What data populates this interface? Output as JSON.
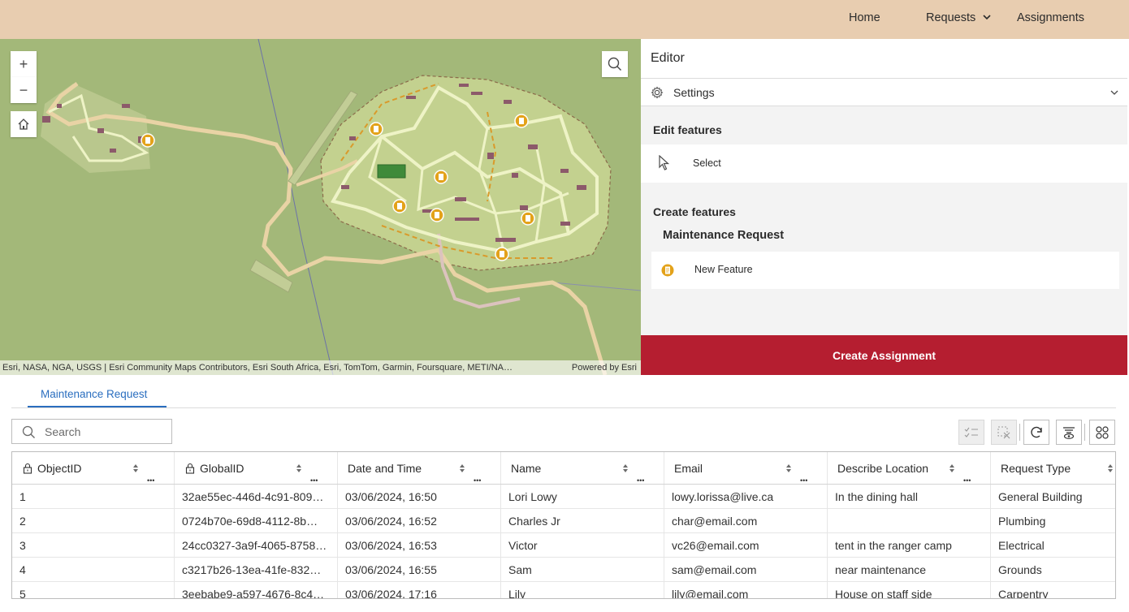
{
  "nav": {
    "home": "Home",
    "requests": "Requests",
    "assignments": "Assignments"
  },
  "map": {
    "zoom_in": "+",
    "zoom_out": "−",
    "attribution": "Esri, NASA, NGA, USGS | Esri Community Maps Contributors, Esri South Africa, Esri, TomTom, Garmin, Foursquare, METI/NA…",
    "powered_by": "Powered by Esri",
    "colors": {
      "land": "#a3b879",
      "campus": "#c3d18f",
      "paths": "#eef3c6",
      "roads": "#e9d3a5",
      "marker": "#e3a21a"
    }
  },
  "editor": {
    "title": "Editor",
    "settings_label": "Settings",
    "edit_features_title": "Edit features",
    "select_label": "Select",
    "create_features_title": "Create features",
    "layer_name": "Maintenance Request",
    "new_feature_label": "New Feature",
    "create_assignment_label": "Create Assignment",
    "accent_color": "#b51e30"
  },
  "table": {
    "tab_label": "Maintenance Request",
    "search_placeholder": "Search",
    "columns": [
      {
        "label": "ObjectID",
        "locked": true
      },
      {
        "label": "GlobalID",
        "locked": true
      },
      {
        "label": "Date and Time",
        "locked": false
      },
      {
        "label": "Name",
        "locked": false
      },
      {
        "label": "Email",
        "locked": false
      },
      {
        "label": "Describe Location",
        "locked": false
      },
      {
        "label": "Request Type",
        "locked": false
      }
    ],
    "rows": [
      [
        "1",
        "32ae55ec-446d-4c91-809…",
        "03/06/2024, 16:50",
        "Lori Lowy",
        "lowy.lorissa@live.ca",
        "In the dining hall",
        "General Building"
      ],
      [
        "2",
        "0724b70e-69d8-4112-8b…",
        "03/06/2024, 16:52",
        "Charles Jr",
        "char@email.com",
        "",
        "Plumbing"
      ],
      [
        "3",
        "24cc0327-3a9f-4065-8758…",
        "03/06/2024, 16:53",
        "Victor",
        "vc26@email.com",
        "tent in the ranger camp",
        "Electrical"
      ],
      [
        "4",
        "c3217b26-13ea-41fe-832…",
        "03/06/2024, 16:55",
        "Sam",
        "sam@email.com",
        "near maintenance",
        "Grounds"
      ],
      [
        "5",
        "3eebabe9-a597-4676-8c4…",
        "03/06/2024, 17:16",
        "Lily",
        "lily@email.com",
        "House on staff side",
        "Carpentry"
      ]
    ]
  }
}
